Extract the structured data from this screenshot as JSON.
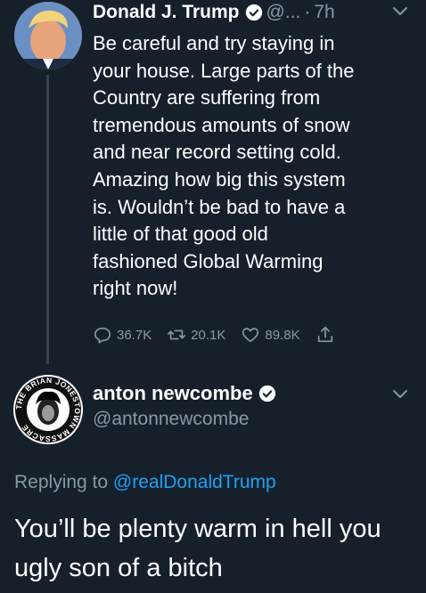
{
  "original_tweet": {
    "display_name": "Donald J. Trump",
    "handle_truncated": "@...",
    "separator": "·",
    "time_ago": "7h",
    "text": "Be careful and try staying in\nyour house. Large parts of the\nCountry are suffering from\ntremendous amounts of snow\nand near record setting cold.\nAmazing how big this system\nis. Wouldn’t be bad to have a\nlittle of that good old\nfashioned Global Warming\nright now!",
    "replies": "36.7K",
    "retweets": "20.1K",
    "likes": "89.8K"
  },
  "reply_tweet": {
    "display_name": "anton newcombe",
    "handle": "@antonnewcombe",
    "avatar_ring_text": "THE BRIAN JONESTOWN MASSACRE",
    "replying_to_prefix": "Replying to ",
    "replying_to_handle": "@realDonaldTrump",
    "text": "You’ll be plenty warm in hell you ugly son of a bitch"
  },
  "icons": {
    "verified": "verified-badge-icon",
    "caret": "chevron-down-icon",
    "reply": "reply-icon",
    "retweet": "retweet-icon",
    "like": "heart-icon",
    "share": "share-icon"
  },
  "colors": {
    "background": "#15202b",
    "text_primary": "#ffffff",
    "text_secondary": "#8899a6",
    "link": "#1da1f2",
    "thread_line": "#38444d"
  }
}
